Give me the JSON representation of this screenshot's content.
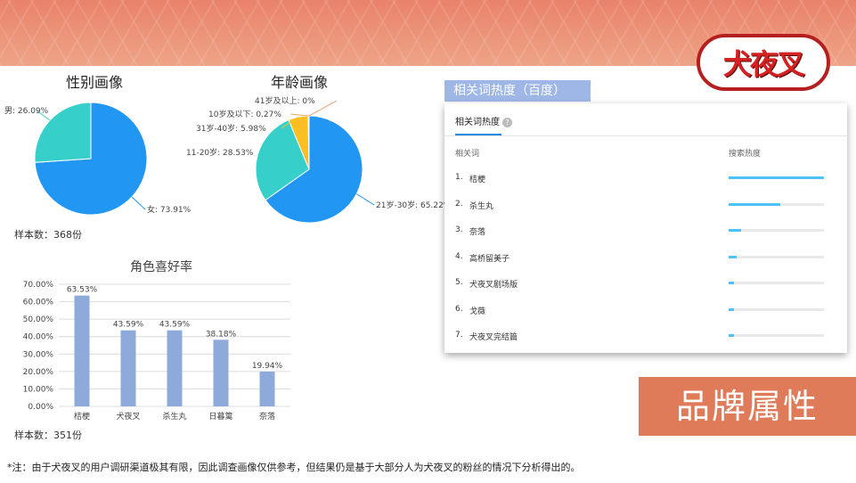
{
  "logo": {
    "text": "犬夜叉"
  },
  "gender": {
    "title": "性别画像",
    "sample": "样本数：368份",
    "colors": [
      "#2196f3",
      "#36cfc9"
    ],
    "chart_data": {
      "type": "pie",
      "slices": [
        {
          "label": "女: 73.91%",
          "value": 73.91
        },
        {
          "label": "男: 26.09%",
          "value": 26.09
        }
      ]
    }
  },
  "age": {
    "title": "年龄画像",
    "colors": [
      "#2196f3",
      "#36cfc9",
      "#fbbf24",
      "#f4a460",
      "#e8a87c"
    ],
    "chart_data": {
      "type": "pie",
      "slices": [
        {
          "label": "21岁-30岁: 65.22%",
          "value": 65.22
        },
        {
          "label": "11-20岁: 28.53%",
          "value": 28.53
        },
        {
          "label": "31岁-40岁: 5.98%",
          "value": 5.98
        },
        {
          "label": "10岁及以下: 0.27%",
          "value": 0.27
        },
        {
          "label": "41岁及以上: 0%",
          "value": 0
        }
      ]
    }
  },
  "roles": {
    "title": "角色喜好率",
    "sample": "样本数：351份",
    "bar_color": "#8eaadb",
    "chart_data": {
      "type": "bar",
      "categories": [
        "桔梗",
        "犬夜叉",
        "杀生丸",
        "日暮篱",
        "奈落"
      ],
      "values": [
        63.53,
        43.59,
        43.59,
        38.18,
        19.94
      ],
      "value_labels": [
        "63.53%",
        "43.59%",
        "43.59%",
        "38.18%",
        "19.94%"
      ],
      "ylim": [
        0,
        70
      ],
      "yticks": [
        "0.00%",
        "10.00%",
        "20.00%",
        "30.00%",
        "40.00%",
        "50.00%",
        "60.00%",
        "70.00%"
      ],
      "grid": true
    }
  },
  "keywords": {
    "header": "相关词热度（百度）",
    "tab": "相关词热度",
    "tab_icon": "?",
    "col_word": "相关词",
    "col_heat": "搜索热度",
    "rows": [
      {
        "num": "1.",
        "word": "桔梗",
        "heat": 1.0
      },
      {
        "num": "2.",
        "word": "杀生丸",
        "heat": 0.54
      },
      {
        "num": "3.",
        "word": "奈落",
        "heat": 0.13
      },
      {
        "num": "4.",
        "word": "高桥留美子",
        "heat": 0.08
      },
      {
        "num": "5.",
        "word": "犬夜叉剧场版",
        "heat": 0.06
      },
      {
        "num": "6.",
        "word": "戈薇",
        "heat": 0.06
      },
      {
        "num": "7.",
        "word": "犬夜叉完结篇",
        "heat": 0.06
      }
    ]
  },
  "attribute": {
    "text": "品牌属性"
  },
  "note": "*注：由于犬夜叉的用户调研渠道极其有限，因此调查画像仅供参考，但结果仍是基于大部分人为犬夜叉的粉丝的情况下分析得出的。"
}
